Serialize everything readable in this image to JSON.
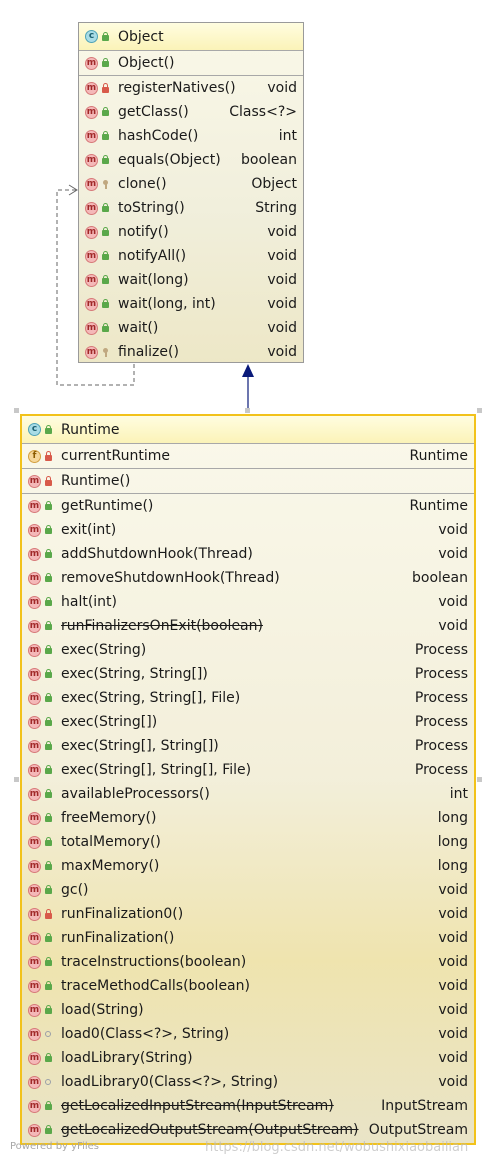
{
  "object_class": {
    "name": "Object",
    "constructor": "Object()",
    "methods": [
      {
        "name": "registerNatives()",
        "type": "void",
        "vis": "priv",
        "icon": "m"
      },
      {
        "name": "getClass()",
        "type": "Class<?>",
        "vis": "pub",
        "icon": "m"
      },
      {
        "name": "hashCode()",
        "type": "int",
        "vis": "pub",
        "icon": "m"
      },
      {
        "name": "equals(Object)",
        "type": "boolean",
        "vis": "pub",
        "icon": "m"
      },
      {
        "name": "clone()",
        "type": "Object",
        "vis": "prot",
        "icon": "m"
      },
      {
        "name": "toString()",
        "type": "String",
        "vis": "pub",
        "icon": "m"
      },
      {
        "name": "notify()",
        "type": "void",
        "vis": "pub",
        "icon": "m"
      },
      {
        "name": "notifyAll()",
        "type": "void",
        "vis": "pub",
        "icon": "m"
      },
      {
        "name": "wait(long)",
        "type": "void",
        "vis": "pub",
        "icon": "m"
      },
      {
        "name": "wait(long, int)",
        "type": "void",
        "vis": "pub",
        "icon": "m"
      },
      {
        "name": "wait()",
        "type": "void",
        "vis": "pub",
        "icon": "m"
      },
      {
        "name": "finalize()",
        "type": "void",
        "vis": "prot",
        "icon": "m"
      }
    ]
  },
  "runtime_class": {
    "name": "Runtime",
    "fields": [
      {
        "name": "currentRuntime",
        "type": "Runtime",
        "vis": "priv",
        "icon": "f"
      }
    ],
    "constructor": "Runtime()",
    "methods": [
      {
        "name": "getRuntime()",
        "type": "Runtime",
        "vis": "pub",
        "icon": "m"
      },
      {
        "name": "exit(int)",
        "type": "void",
        "vis": "pub",
        "icon": "m"
      },
      {
        "name": "addShutdownHook(Thread)",
        "type": "void",
        "vis": "pub",
        "icon": "m"
      },
      {
        "name": "removeShutdownHook(Thread)",
        "type": "boolean",
        "vis": "pub",
        "icon": "m"
      },
      {
        "name": "halt(int)",
        "type": "void",
        "vis": "pub",
        "icon": "m"
      },
      {
        "name": "runFinalizersOnExit(boolean)",
        "type": "void",
        "vis": "pub",
        "icon": "m",
        "deprecated": true
      },
      {
        "name": "exec(String)",
        "type": "Process",
        "vis": "pub",
        "icon": "m"
      },
      {
        "name": "exec(String, String[])",
        "type": "Process",
        "vis": "pub",
        "icon": "m"
      },
      {
        "name": "exec(String, String[], File)",
        "type": "Process",
        "vis": "pub",
        "icon": "m"
      },
      {
        "name": "exec(String[])",
        "type": "Process",
        "vis": "pub",
        "icon": "m"
      },
      {
        "name": "exec(String[], String[])",
        "type": "Process",
        "vis": "pub",
        "icon": "m"
      },
      {
        "name": "exec(String[], String[], File)",
        "type": "Process",
        "vis": "pub",
        "icon": "m"
      },
      {
        "name": "availableProcessors()",
        "type": "int",
        "vis": "pub",
        "icon": "m"
      },
      {
        "name": "freeMemory()",
        "type": "long",
        "vis": "pub",
        "icon": "m"
      },
      {
        "name": "totalMemory()",
        "type": "long",
        "vis": "pub",
        "icon": "m"
      },
      {
        "name": "maxMemory()",
        "type": "long",
        "vis": "pub",
        "icon": "m"
      },
      {
        "name": "gc()",
        "type": "void",
        "vis": "pub",
        "icon": "m"
      },
      {
        "name": "runFinalization0()",
        "type": "void",
        "vis": "priv",
        "icon": "m"
      },
      {
        "name": "runFinalization()",
        "type": "void",
        "vis": "pub",
        "icon": "m"
      },
      {
        "name": "traceInstructions(boolean)",
        "type": "void",
        "vis": "pub",
        "icon": "m"
      },
      {
        "name": "traceMethodCalls(boolean)",
        "type": "void",
        "vis": "pub",
        "icon": "m"
      },
      {
        "name": "load(String)",
        "type": "void",
        "vis": "pub",
        "icon": "m"
      },
      {
        "name": "load0(Class<?>, String)",
        "type": "void",
        "vis": "pkg",
        "icon": "m"
      },
      {
        "name": "loadLibrary(String)",
        "type": "void",
        "vis": "pub",
        "icon": "m"
      },
      {
        "name": "loadLibrary0(Class<?>, String)",
        "type": "void",
        "vis": "pkg",
        "icon": "m"
      },
      {
        "name": "getLocalizedInputStream(InputStream)",
        "type": "InputStream",
        "vis": "pub",
        "icon": "m",
        "deprecated": true
      },
      {
        "name": "getLocalizedOutputStream(OutputStream)",
        "type": "OutputStream",
        "vis": "pub",
        "icon": "m",
        "deprecated": true
      }
    ]
  },
  "footer": "Powered by yFiles",
  "watermark": "https://blog.csdn.net/wobushixiaobailian",
  "colors": {
    "selected_border": "#f2c21a",
    "header_fill": "#fbf3b8",
    "inheritance_arrow": "#0a1a7a"
  }
}
